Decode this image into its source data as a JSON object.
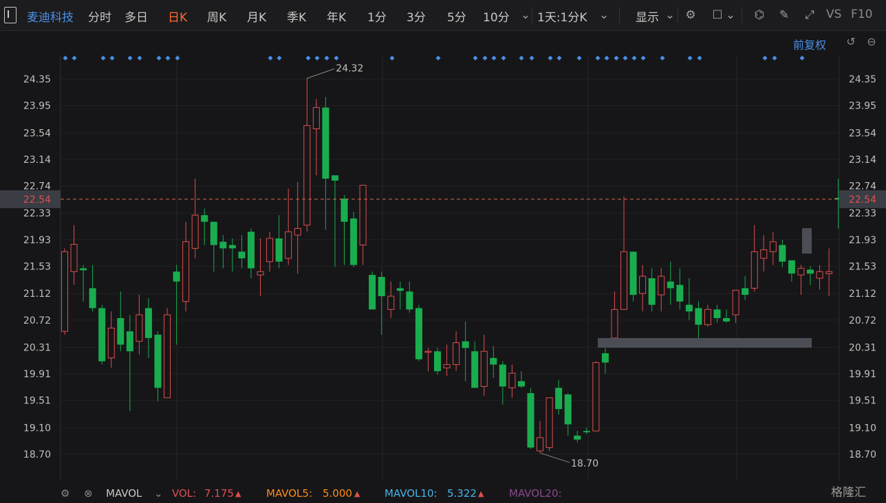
{
  "toolbar": {
    "title": "麦迪科技",
    "tabs": [
      "分时",
      "多日",
      "日K",
      "周K",
      "月K",
      "季K",
      "年K",
      "1分",
      "3分",
      "5分",
      "10分"
    ],
    "active_tab": "日K",
    "interval": "1天:1分K",
    "display": "显示",
    "vs": "VS",
    "f10": "F10"
  },
  "fuquan": "前复权",
  "colors": {
    "up": "#e04f4f",
    "down": "#1aad4f",
    "accent": "#4a8fe8",
    "active": "#ff6a2e",
    "bg": "#161618"
  },
  "chart_data": {
    "type": "candlestick",
    "title": "",
    "ylim": [
      18.5,
      24.45
    ],
    "y_ticks": [
      "24.35",
      "23.95",
      "23.54",
      "23.14",
      "22.74",
      "22.33",
      "21.93",
      "21.53",
      "21.12",
      "20.72",
      "20.31",
      "19.91",
      "19.51",
      "19.10",
      "18.70"
    ],
    "current_price": "22.54",
    "annotations": {
      "high": "24.32",
      "low": "18.70"
    },
    "candles": [
      [
        20.55,
        21.75,
        21.8,
        20.5
      ],
      [
        21.45,
        21.86,
        22.15,
        21.25
      ],
      [
        21.5,
        21.47,
        21.55,
        21.0
      ],
      [
        21.2,
        20.9,
        21.55,
        20.85
      ],
      [
        20.9,
        20.1,
        20.95,
        20.05
      ],
      [
        20.15,
        20.6,
        20.85,
        20.0
      ],
      [
        20.75,
        20.35,
        21.15,
        20.25
      ],
      [
        20.55,
        20.25,
        20.8,
        19.35
      ],
      [
        20.4,
        20.8,
        21.1,
        20.2
      ],
      [
        20.9,
        20.45,
        21.05,
        20.15
      ],
      [
        20.5,
        19.7,
        20.55,
        19.5
      ],
      [
        19.55,
        20.8,
        20.9,
        19.55
      ],
      [
        21.45,
        21.3,
        21.55,
        20.35
      ],
      [
        21.0,
        21.9,
        22.2,
        20.85
      ],
      [
        21.8,
        22.3,
        22.85,
        21.65
      ],
      [
        22.3,
        22.2,
        22.4,
        21.85
      ],
      [
        22.2,
        21.85,
        22.2,
        21.45
      ],
      [
        21.9,
        21.8,
        22.0,
        21.5
      ],
      [
        21.85,
        21.8,
        21.95,
        21.45
      ],
      [
        21.75,
        21.65,
        22.0,
        21.5
      ],
      [
        22.05,
        21.5,
        22.1,
        21.35
      ],
      [
        21.4,
        21.45,
        21.95,
        21.08
      ],
      [
        21.6,
        21.95,
        22.05,
        21.45
      ],
      [
        21.95,
        21.6,
        22.3,
        21.5
      ],
      [
        21.65,
        22.05,
        22.7,
        21.55
      ],
      [
        22.0,
        22.1,
        22.8,
        21.42
      ],
      [
        22.15,
        23.65,
        24.36,
        22.05
      ],
      [
        23.6,
        23.92,
        24.05,
        22.9
      ],
      [
        23.92,
        22.85,
        24.08,
        22.08
      ],
      [
        22.9,
        22.82,
        22.85,
        21.52
      ],
      [
        22.55,
        22.2,
        22.6,
        21.55
      ],
      [
        22.25,
        21.55,
        22.35,
        21.52
      ],
      [
        21.85,
        22.75,
        22.75,
        21.55
      ],
      [
        21.4,
        20.88,
        21.45,
        20.88
      ],
      [
        21.37,
        21.08,
        21.45,
        20.5
      ],
      [
        20.88,
        21.08,
        21.3,
        20.75
      ],
      [
        21.2,
        21.16,
        21.3,
        20.88
      ],
      [
        21.15,
        20.88,
        21.3,
        20.83
      ],
      [
        20.9,
        20.13,
        20.95,
        20.1
      ],
      [
        20.25,
        20.25,
        20.3,
        19.95
      ],
      [
        20.25,
        19.95,
        20.3,
        19.9
      ],
      [
        20.0,
        20.05,
        20.35,
        19.88
      ],
      [
        20.05,
        20.38,
        20.55,
        19.95
      ],
      [
        20.4,
        20.3,
        20.7,
        19.8
      ],
      [
        20.25,
        19.7,
        20.4,
        19.7
      ],
      [
        19.72,
        20.25,
        20.5,
        19.58
      ],
      [
        20.15,
        20.05,
        20.33,
        19.85
      ],
      [
        20.05,
        19.72,
        20.1,
        19.45
      ],
      [
        19.7,
        19.92,
        20.05,
        19.55
      ],
      [
        19.8,
        19.72,
        19.95,
        19.7
      ],
      [
        19.62,
        18.8,
        19.7,
        18.78
      ],
      [
        18.75,
        18.95,
        19.2,
        18.72
      ],
      [
        18.8,
        19.55,
        19.55,
        18.75
      ],
      [
        19.7,
        19.38,
        19.82,
        19.3
      ],
      [
        19.6,
        19.15,
        19.62,
        18.98
      ],
      [
        18.98,
        18.92,
        19.05,
        18.88
      ],
      [
        19.05,
        19.03,
        19.1,
        19.0
      ],
      [
        19.05,
        20.08,
        20.1,
        19.05
      ],
      [
        20.22,
        20.08,
        20.3,
        19.91
      ],
      [
        20.45,
        20.88,
        21.15,
        20.42
      ]
    ],
    "candles_b": [
      [
        20.88,
        21.75,
        22.58,
        21.1
      ],
      [
        21.75,
        21.1,
        21.75,
        21.0
      ],
      [
        21.12,
        21.38,
        21.55,
        20.85
      ],
      [
        21.35,
        20.95,
        21.5,
        20.85
      ],
      [
        21.1,
        21.38,
        21.5,
        20.85
      ],
      [
        21.3,
        21.2,
        21.6,
        20.95
      ],
      [
        21.25,
        21.0,
        21.5,
        20.88
      ],
      [
        20.95,
        20.85,
        21.35,
        20.72
      ],
      [
        20.9,
        20.65,
        21.0,
        20.45
      ],
      [
        20.65,
        20.88,
        20.95,
        20.62
      ],
      [
        20.88,
        20.75,
        20.95,
        20.68
      ],
      [
        20.75,
        20.7,
        20.88,
        20.68
      ],
      [
        20.8,
        21.17,
        21.1,
        20.68
      ],
      [
        21.2,
        21.1,
        21.38,
        21.02
      ],
      [
        21.2,
        21.75,
        22.15,
        21.15
      ],
      [
        21.65,
        21.78,
        22.0,
        21.45
      ],
      [
        21.75,
        21.9,
        22.05,
        21.55
      ],
      [
        21.85,
        21.6,
        21.93,
        21.52
      ],
      [
        21.62,
        21.42,
        21.48,
        21.3
      ],
      [
        21.4,
        21.5,
        21.55,
        21.1
      ],
      [
        21.48,
        21.42,
        21.53,
        21.25
      ],
      [
        21.35,
        21.45,
        21.55,
        21.18
      ],
      [
        21.42,
        21.45,
        21.8,
        21.08
      ],
      [
        22.56,
        22.54,
        22.85,
        22.1
      ]
    ],
    "mavol": {
      "label": "MAVOL",
      "vol": "VOL:",
      "vol_val": "7.175",
      "ma5": "MAVOL5:",
      "ma5_val": "5.000",
      "ma10": "MAVOL10:",
      "ma10_val": "5.322",
      "ma20": "MAVOL20:"
    }
  },
  "brand": "格隆汇"
}
